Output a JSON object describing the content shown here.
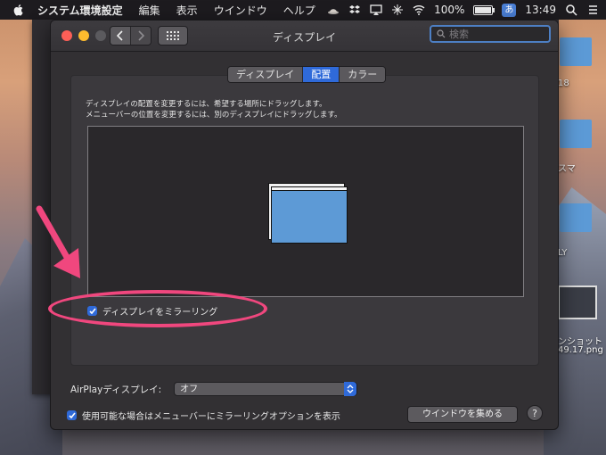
{
  "menubar": {
    "app_name": "システム環境設定",
    "items": [
      "編集",
      "表示",
      "ウインドウ",
      "ヘルプ"
    ],
    "battery": "100%",
    "input_lang": "あ",
    "clock": "13:49"
  },
  "desktop": {
    "labels": [
      "18",
      "スマ",
      "LY",
      "ンショット",
      "49.17.png"
    ]
  },
  "window": {
    "title": "ディスプレイ",
    "search_placeholder": "検索",
    "tabs": [
      {
        "label": "ディスプレイ",
        "active": false
      },
      {
        "label": "配置",
        "active": true
      },
      {
        "label": "カラー",
        "active": false
      }
    ],
    "description_line1": "ディスプレイの配置を変更するには、希望する場所にドラッグします。",
    "description_line2": "メニューバーの位置を変更するには、別のディスプレイにドラッグします。",
    "mirror_label": "ディスプレイをミラーリング",
    "mirror_checked": true,
    "airplay_label": "AirPlayディスプレイ:",
    "airplay_value": "オフ",
    "menu_option_label": "使用可能な場合はメニューバーにミラーリングオプションを表示",
    "menu_option_checked": true,
    "gather_button": "ウインドウを集める",
    "help_button": "?"
  },
  "colors": {
    "accent": "#2f6ad9",
    "highlight": "#f0477e",
    "display": "#5d9ad6"
  }
}
